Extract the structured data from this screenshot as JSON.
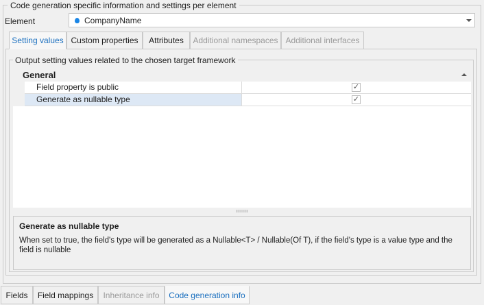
{
  "group": {
    "title": "Code generation specific information and settings per element"
  },
  "element": {
    "label": "Element",
    "selected": "CompanyName"
  },
  "tabs": [
    {
      "label": "Setting values"
    },
    {
      "label": "Custom properties"
    },
    {
      "label": "Attributes"
    },
    {
      "label": "Additional namespaces"
    },
    {
      "label": "Additional interfaces"
    }
  ],
  "output_group": {
    "title": "Output setting values related to the chosen target framework"
  },
  "grid": {
    "category": "General",
    "rows": [
      {
        "name": "Field property is public",
        "checked": true
      },
      {
        "name": "Generate as nullable type",
        "checked": true
      }
    ]
  },
  "description": {
    "title": "Generate as nullable type",
    "text": "When set to true, the field's type will be generated as a Nullable<T> / Nullable(Of T), if the field's type is a value type and the field is nullable"
  },
  "bottom_tabs": [
    {
      "label": "Fields"
    },
    {
      "label": "Field mappings"
    },
    {
      "label": "Inheritance info"
    },
    {
      "label": "Code generation info"
    }
  ],
  "colors": {
    "accent": "#1a6fbf",
    "selection": "#dde8f5",
    "element_icon": "#1a86e6"
  }
}
